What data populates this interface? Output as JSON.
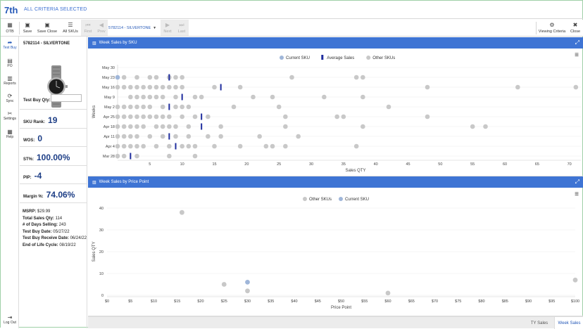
{
  "header": {
    "brand": "7th",
    "criteria": "ALL CRITERIA SELECTED"
  },
  "toolbar": {
    "otb": "OTB",
    "save": "Save",
    "save_close": "Save Close",
    "all_skus": "All SKUs",
    "first": "First",
    "prev": "Prev",
    "sku_select": "5782114 - SILVERTONE",
    "next": "Next",
    "last": "Last",
    "viewing_criteria": "Viewing Criteria",
    "close": "Close"
  },
  "nav": {
    "items": [
      "Test Buy",
      "PO",
      "Reports",
      "Sync",
      "Settings",
      "Help"
    ],
    "logout": "Log Out"
  },
  "product": {
    "title": "5782114 - SILVERTONE",
    "test_buy_qty_label": "Test Buy Qty:",
    "test_buy_qty_value": "",
    "sku_rank_label": "SKU Rank:",
    "sku_rank": "19",
    "wos_label": "WOS:",
    "wos": "0",
    "st_label": "ST%:",
    "st": "100.00%",
    "pip_label": "PIP:",
    "pip": "-4",
    "margin_label": "Margin %:",
    "margin": "74.06%",
    "msrp_label": "MSRP:",
    "msrp": "$29.99",
    "total_sales_label": "Total Sales Qty:",
    "total_sales": "114",
    "days_selling_label": "# of Days Selling:",
    "days_selling": "243",
    "test_buy_date_label": "Test Buy Date:",
    "test_buy_date": "05/27/22",
    "receive_date_label": "Test Buy Receive Date:",
    "receive_date": "06/24/22",
    "eol_label": "End of Life Cycle:",
    "eol": "08/19/22"
  },
  "tabs": {
    "ty_sales": "TY Sales",
    "week_sales": "Week Sales"
  },
  "colors": {
    "accent": "#3e74d4",
    "current": "#9fb6d9",
    "other": "#c8c8c8",
    "average": "#1f2d9e",
    "dark_value": "#1d3e86"
  },
  "chart_data": [
    {
      "type": "scatter",
      "title": "Week Sales by SKU",
      "xlabel": "Sales QTY",
      "ylabel": "Weeks",
      "xlim": [
        0,
        72
      ],
      "xticks": [
        5,
        10,
        15,
        20,
        25,
        30,
        35,
        40,
        45,
        50,
        55,
        60,
        65,
        70
      ],
      "categories": [
        "May 30",
        "May 23",
        "May 16",
        "May 9",
        "May 2",
        "Apr 25",
        "Apr 18",
        "Apr 11",
        "Apr 4",
        "Mar 28"
      ],
      "legend": [
        "Current SKU",
        "Average Sales",
        "Other SKUs"
      ],
      "legend_position": "top-center",
      "series": [
        {
          "name": "Current SKU",
          "points": [
            [
              0,
              1
            ]
          ]
        },
        {
          "name": "Average Sales",
          "points": [
            [
              8,
              1
            ],
            [
              16,
              2
            ],
            [
              10,
              3
            ],
            [
              8,
              4
            ],
            [
              13,
              5
            ],
            [
              13,
              6
            ],
            [
              8,
              7
            ],
            [
              9,
              8
            ],
            [
              2,
              9
            ]
          ]
        },
        {
          "name": "Other SKUs",
          "points": [
            [
              1,
              1
            ],
            [
              3,
              1
            ],
            [
              5,
              1
            ],
            [
              6,
              1
            ],
            [
              8,
              1
            ],
            [
              9,
              1
            ],
            [
              10,
              1
            ],
            [
              27,
              1
            ],
            [
              37,
              1
            ],
            [
              38,
              1
            ],
            [
              0,
              2
            ],
            [
              1,
              2
            ],
            [
              2,
              2
            ],
            [
              3,
              2
            ],
            [
              4,
              2
            ],
            [
              5,
              2
            ],
            [
              6,
              2
            ],
            [
              7,
              2
            ],
            [
              8,
              2
            ],
            [
              9,
              2
            ],
            [
              10,
              2
            ],
            [
              15,
              2
            ],
            [
              19,
              2
            ],
            [
              48,
              2
            ],
            [
              62,
              2
            ],
            [
              71,
              2
            ],
            [
              2,
              3
            ],
            [
              3,
              3
            ],
            [
              4,
              3
            ],
            [
              5,
              3
            ],
            [
              6,
              3
            ],
            [
              7,
              3
            ],
            [
              9,
              3
            ],
            [
              12,
              3
            ],
            [
              13,
              3
            ],
            [
              21,
              3
            ],
            [
              24,
              3
            ],
            [
              32,
              3
            ],
            [
              38,
              3
            ],
            [
              0,
              4
            ],
            [
              1,
              4
            ],
            [
              2,
              4
            ],
            [
              3,
              4
            ],
            [
              4,
              4
            ],
            [
              5,
              4
            ],
            [
              7,
              4
            ],
            [
              9,
              4
            ],
            [
              10,
              4
            ],
            [
              11,
              4
            ],
            [
              18,
              4
            ],
            [
              25,
              4
            ],
            [
              42,
              4
            ],
            [
              0,
              5
            ],
            [
              1,
              5
            ],
            [
              2,
              5
            ],
            [
              3,
              5
            ],
            [
              4,
              5
            ],
            [
              5,
              5
            ],
            [
              6,
              5
            ],
            [
              7,
              5
            ],
            [
              8,
              5
            ],
            [
              10,
              5
            ],
            [
              12,
              5
            ],
            [
              14,
              5
            ],
            [
              26,
              5
            ],
            [
              34,
              5
            ],
            [
              35,
              5
            ],
            [
              48,
              5
            ],
            [
              0,
              6
            ],
            [
              1,
              6
            ],
            [
              2,
              6
            ],
            [
              3,
              6
            ],
            [
              4,
              6
            ],
            [
              6,
              6
            ],
            [
              7,
              6
            ],
            [
              8,
              6
            ],
            [
              9,
              6
            ],
            [
              11,
              6
            ],
            [
              16,
              6
            ],
            [
              26,
              6
            ],
            [
              38,
              6
            ],
            [
              55,
              6
            ],
            [
              57,
              6
            ],
            [
              0,
              7
            ],
            [
              1,
              7
            ],
            [
              2,
              7
            ],
            [
              3,
              7
            ],
            [
              5,
              7
            ],
            [
              7,
              7
            ],
            [
              9,
              7
            ],
            [
              11,
              7
            ],
            [
              14,
              7
            ],
            [
              16,
              7
            ],
            [
              22,
              7
            ],
            [
              28,
              7
            ],
            [
              0,
              8
            ],
            [
              1,
              8
            ],
            [
              2,
              8
            ],
            [
              3,
              8
            ],
            [
              4,
              8
            ],
            [
              6,
              8
            ],
            [
              8,
              8
            ],
            [
              10,
              8
            ],
            [
              11,
              8
            ],
            [
              12,
              8
            ],
            [
              15,
              8
            ],
            [
              19,
              8
            ],
            [
              23,
              8
            ],
            [
              24,
              8
            ],
            [
              26,
              8
            ],
            [
              37,
              8
            ],
            [
              0,
              9
            ],
            [
              1,
              9
            ],
            [
              3,
              9
            ],
            [
              8,
              9
            ],
            [
              12,
              9
            ]
          ]
        }
      ]
    },
    {
      "type": "scatter",
      "title": "Week Sales by Price Point",
      "xlabel": "Price Point",
      "ylabel": "Sales QTY",
      "xlim": [
        0,
        100
      ],
      "ylim": [
        0,
        40
      ],
      "xticks": [
        "$0",
        "$5",
        "$10",
        "$15",
        "$20",
        "$25",
        "$30",
        "$35",
        "$40",
        "$45",
        "$50",
        "$55",
        "$60",
        "$65",
        "$70",
        "$75",
        "$80",
        "$85",
        "$90",
        "$95",
        "$100"
      ],
      "yticks": [
        0,
        10,
        20,
        30,
        40
      ],
      "legend": [
        "Other SKUs",
        "Current SKU"
      ],
      "legend_position": "top-center",
      "series": [
        {
          "name": "Other SKUs",
          "points": [
            [
              16,
              38
            ],
            [
              25,
              5
            ],
            [
              30,
              2
            ],
            [
              60,
              1
            ],
            [
              100,
              7
            ]
          ]
        },
        {
          "name": "Current SKU",
          "points": [
            [
              30,
              6
            ]
          ]
        }
      ]
    }
  ]
}
